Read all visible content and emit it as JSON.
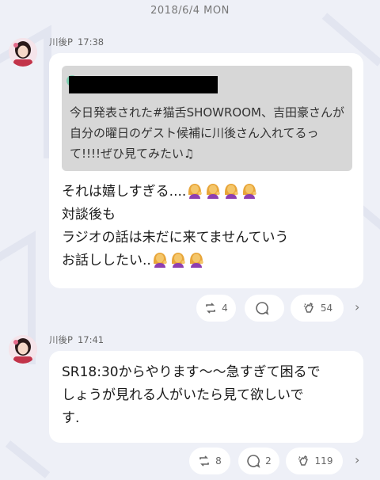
{
  "date_header": "2018/6/4 MON",
  "messages": [
    {
      "author": "川後P",
      "time": "17:38",
      "quote_text": "今日発表された#猫舌SHOWROOM、吉田豪さんが自分の曜日のゲスト候補に川後さん入れてるって!!!!ぜひ見てみたい♫",
      "lines": [
        "それは嬉しすぎる....",
        "対談後も",
        "ラジオの話は未だに来てませんていう",
        "お話ししたい.."
      ],
      "retweets": "4",
      "replies": "",
      "claps": "54"
    },
    {
      "author": "川後P",
      "time": "17:41",
      "lines": [
        "SR18:30からやります〜〜急すぎて困るで",
        "しょうが見れる人がいたら見て欲しいで",
        "す."
      ],
      "retweets": "8",
      "replies": "2",
      "claps": "119"
    }
  ],
  "icons": {
    "retweet": "retweet-icon",
    "reply": "reply-icon",
    "clap": "clap-icon",
    "emoji": "woman-tipping-hand-emoji",
    "more": "chevron-right-icon"
  },
  "colors": {
    "background": "#eef0f7",
    "bubble": "#ffffff",
    "quote": "#d7d7d7"
  }
}
